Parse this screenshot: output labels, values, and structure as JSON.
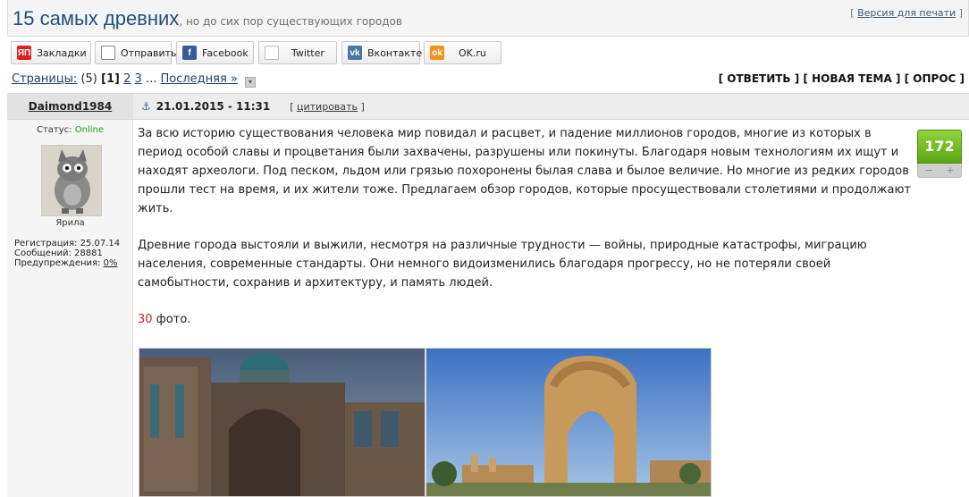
{
  "header": {
    "title": "15 самых древних",
    "subtitle": ", но до сих пор существующих городов",
    "print_open": "[ ",
    "print_label": "Версия для печати",
    "print_close": " ]"
  },
  "share": [
    {
      "icon": "yandex-icon",
      "icon_glyph": "ЯП",
      "label": "Закладки"
    },
    {
      "icon": "mail-icon",
      "icon_glyph": "✉",
      "label": "Отправить"
    },
    {
      "icon": "facebook-icon",
      "icon_glyph": "f",
      "label": "Facebook"
    },
    {
      "icon": "twitter-icon",
      "icon_glyph": "t",
      "label": "Twitter"
    },
    {
      "icon": "vkontakte-icon",
      "icon_glyph": "vk",
      "label": "Вконтакте"
    },
    {
      "icon": "odnoklassniki-icon",
      "icon_glyph": "ok",
      "label": "OK.ru"
    }
  ],
  "pager": {
    "label": "Страницы:",
    "count": "(5)",
    "current": "[1]",
    "pages": [
      "2",
      "3"
    ],
    "ellipsis": "...",
    "last": "Последняя »"
  },
  "actions": "[ ОТВЕТИТЬ ] [ НОВАЯ ТЕМА ] [ ОПРОС ]",
  "post": {
    "author": "Daimond1984",
    "date": "21.01.2015 - 11:31",
    "quote_open": "[ ",
    "quote_label": "цитировать",
    "quote_close": " ]",
    "status_label": "Статус:",
    "status_value": "Online",
    "avatar_name": "Ярила",
    "registration": "Регистрация: 25.07.14",
    "messages": "Сообщений: 28881",
    "warnings_label": "Предупреждения:",
    "warnings_value": "0%",
    "rating": "172",
    "rating_minus": "−",
    "rating_plus": "+",
    "paragraph1": "За всю историю существования человека мир повидал и расцвет, и падение миллионов городов, многие из которых в период особой славы и процветания были захвачены, разрушены или покинуты. Благодаря новым технологиям их ищут и находят археологи. Под песком, льдом или грязью похоронены былая слава и былое величие. Но многие из редких городов прошли тест на время, и их жители тоже. Предлагаем обзор городов, которые просуществовали столетиями и продолжают жить.",
    "paragraph2": "Древние города выстояли и выжили, несмотря на различные трудности — войны, природные катастрофы, миграцию населения, современные стандарты. Они немного видоизменились благодаря прогрессу, но не потеряли своей самобытности, сохранив и архитектуру, и память людей.",
    "photo_count": "30",
    "photo_suffix": " фото."
  },
  "colors": {
    "title": "#1f4f7f",
    "online": "#20a020",
    "rating_green": "#6cb820",
    "photo_count": "#c0282c"
  }
}
